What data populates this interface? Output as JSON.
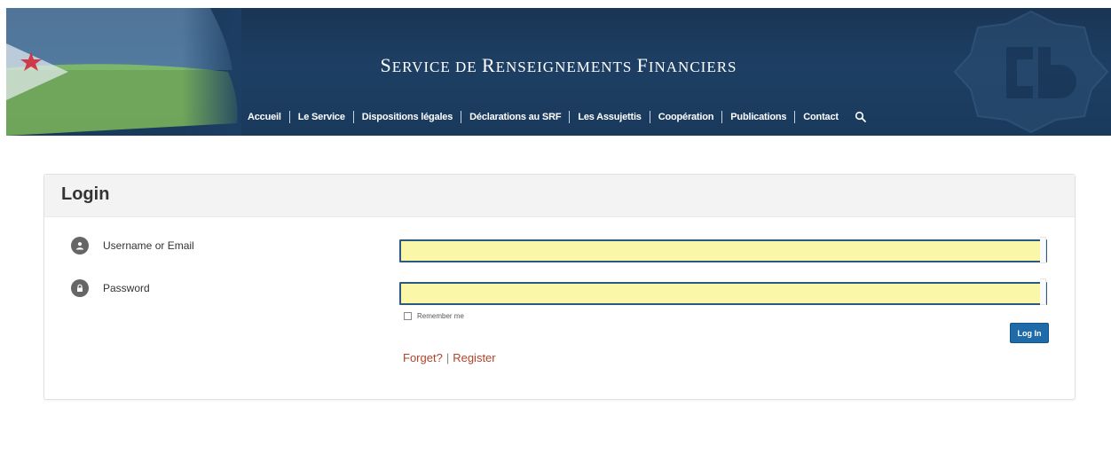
{
  "header": {
    "title": "Service de Renseignements Financiers",
    "title_parts": [
      {
        "cap": "S",
        "rest": "ervice"
      },
      {
        "cap": "",
        "rest": "de"
      },
      {
        "cap": "R",
        "rest": "enseignements"
      },
      {
        "cap": "F",
        "rest": "inanciers"
      }
    ],
    "nav": [
      "Accueil",
      "Le Service",
      "Dispositions légales",
      "Déclarations au SRF",
      "Les Assujettis",
      "Coopération",
      "Publications",
      "Contact"
    ],
    "search_icon": "search-icon",
    "colors": {
      "banner": "#1d3f63",
      "text": "#ffffff"
    }
  },
  "login": {
    "title": "Login",
    "username_label": "Username or Email",
    "username_value": "",
    "username_icon": "user-icon",
    "password_label": "Password",
    "password_value": "",
    "password_icon": "lock-icon",
    "remember_label": "Remember me",
    "remember_checked": false,
    "submit_label": "Log In",
    "forget_label": "Forget?",
    "separator": "|",
    "register_label": "Register",
    "colors": {
      "accent": "#1f6aa8",
      "link": "#b0432a",
      "input_bg": "#fbf7a8",
      "input_border": "#2b5a80"
    }
  }
}
